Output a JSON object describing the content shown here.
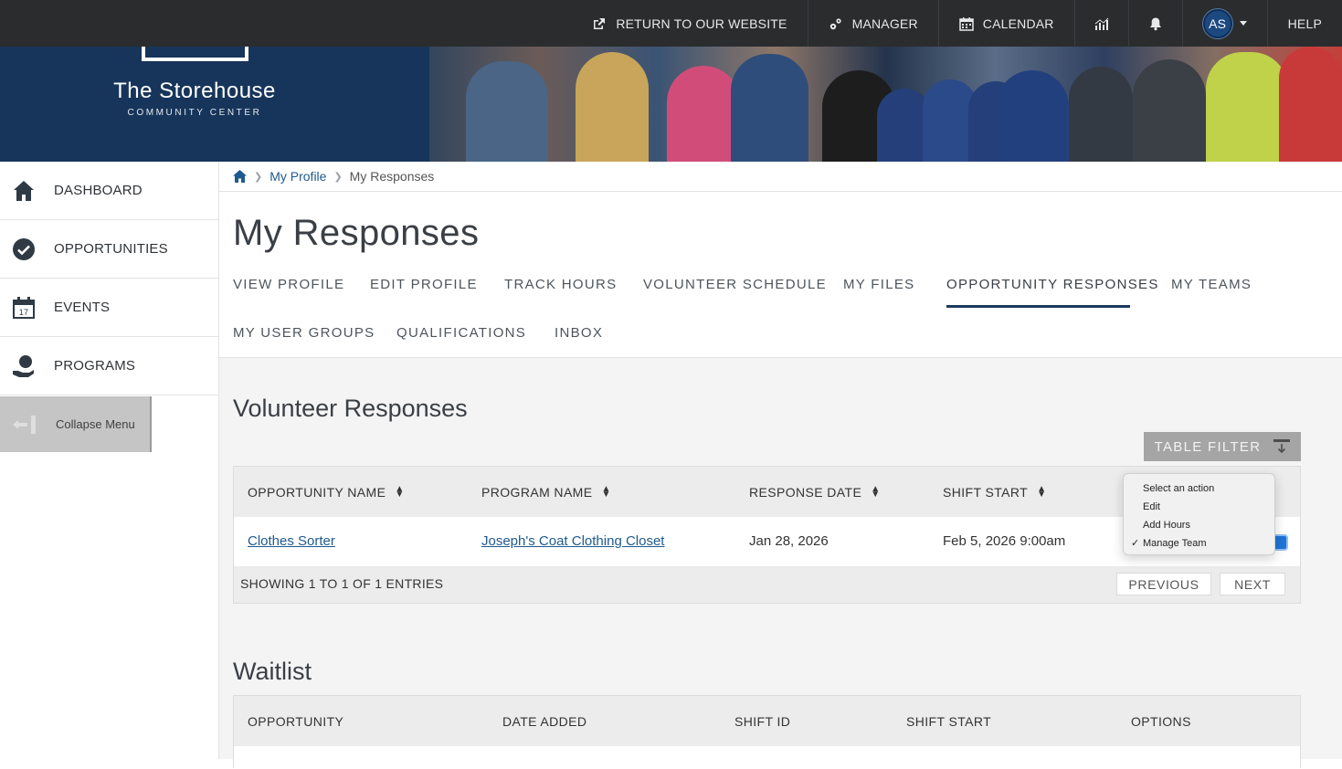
{
  "topbar": {
    "return_label": "RETURN TO OUR WEBSITE",
    "manager_label": "MANAGER",
    "calendar_label": "CALENDAR",
    "avatar_initials": "AS",
    "help_label": "HELP"
  },
  "banner": {
    "org_name": "The Storehouse",
    "org_sub": "COMMUNITY CENTER"
  },
  "sidebar": {
    "items": [
      {
        "label": "DASHBOARD",
        "icon": "home-icon"
      },
      {
        "label": "OPPORTUNITIES",
        "icon": "check-circle-icon"
      },
      {
        "label": "EVENTS",
        "icon": "calendar-icon"
      },
      {
        "label": "PROGRAMS",
        "icon": "hand-globe-icon"
      }
    ],
    "collapse_label": "Collapse Menu"
  },
  "breadcrumb": {
    "profile": "My Profile",
    "current": "My Responses"
  },
  "page_title": "My Responses",
  "tabs": [
    {
      "label": "VIEW PROFILE"
    },
    {
      "label": "EDIT PROFILE"
    },
    {
      "label": "TRACK HOURS"
    },
    {
      "label": "VOLUNTEER SCHEDULE"
    },
    {
      "label": "MY FILES"
    },
    {
      "label": "OPPORTUNITY RESPONSES",
      "active": true
    },
    {
      "label": "MY TEAMS"
    },
    {
      "label": "MY USER GROUPS"
    },
    {
      "label": "QUALIFICATIONS"
    },
    {
      "label": "INBOX"
    }
  ],
  "responses": {
    "title": "Volunteer Responses",
    "filter_label": "TABLE FILTER",
    "columns": [
      "OPPORTUNITY NAME",
      "PROGRAM NAME",
      "RESPONSE DATE",
      "SHIFT START"
    ],
    "rows": [
      {
        "opportunity": "Clothes Sorter",
        "program": "Joseph's Coat Clothing Closet",
        "response_date": "Jan 28, 2026",
        "shift_start": "Feb 5, 2026 9:00am"
      }
    ],
    "showing": "SHOWING 1 TO 1 OF 1 ENTRIES",
    "previous": "PREVIOUS",
    "next": "NEXT"
  },
  "action_menu": {
    "options": [
      "Select an action",
      "Edit",
      "Add Hours",
      "Manage Team"
    ],
    "selected": "Manage Team"
  },
  "waitlist": {
    "title": "Waitlist",
    "columns": [
      "OPPORTUNITY",
      "DATE ADDED",
      "SHIFT ID",
      "SHIFT START",
      "OPTIONS"
    ]
  },
  "colors": {
    "topbar": "#2b2c2e",
    "banner": "#1e3b5e",
    "link": "#1e5a8f",
    "tab_active_underline": "#1b3a5f"
  }
}
